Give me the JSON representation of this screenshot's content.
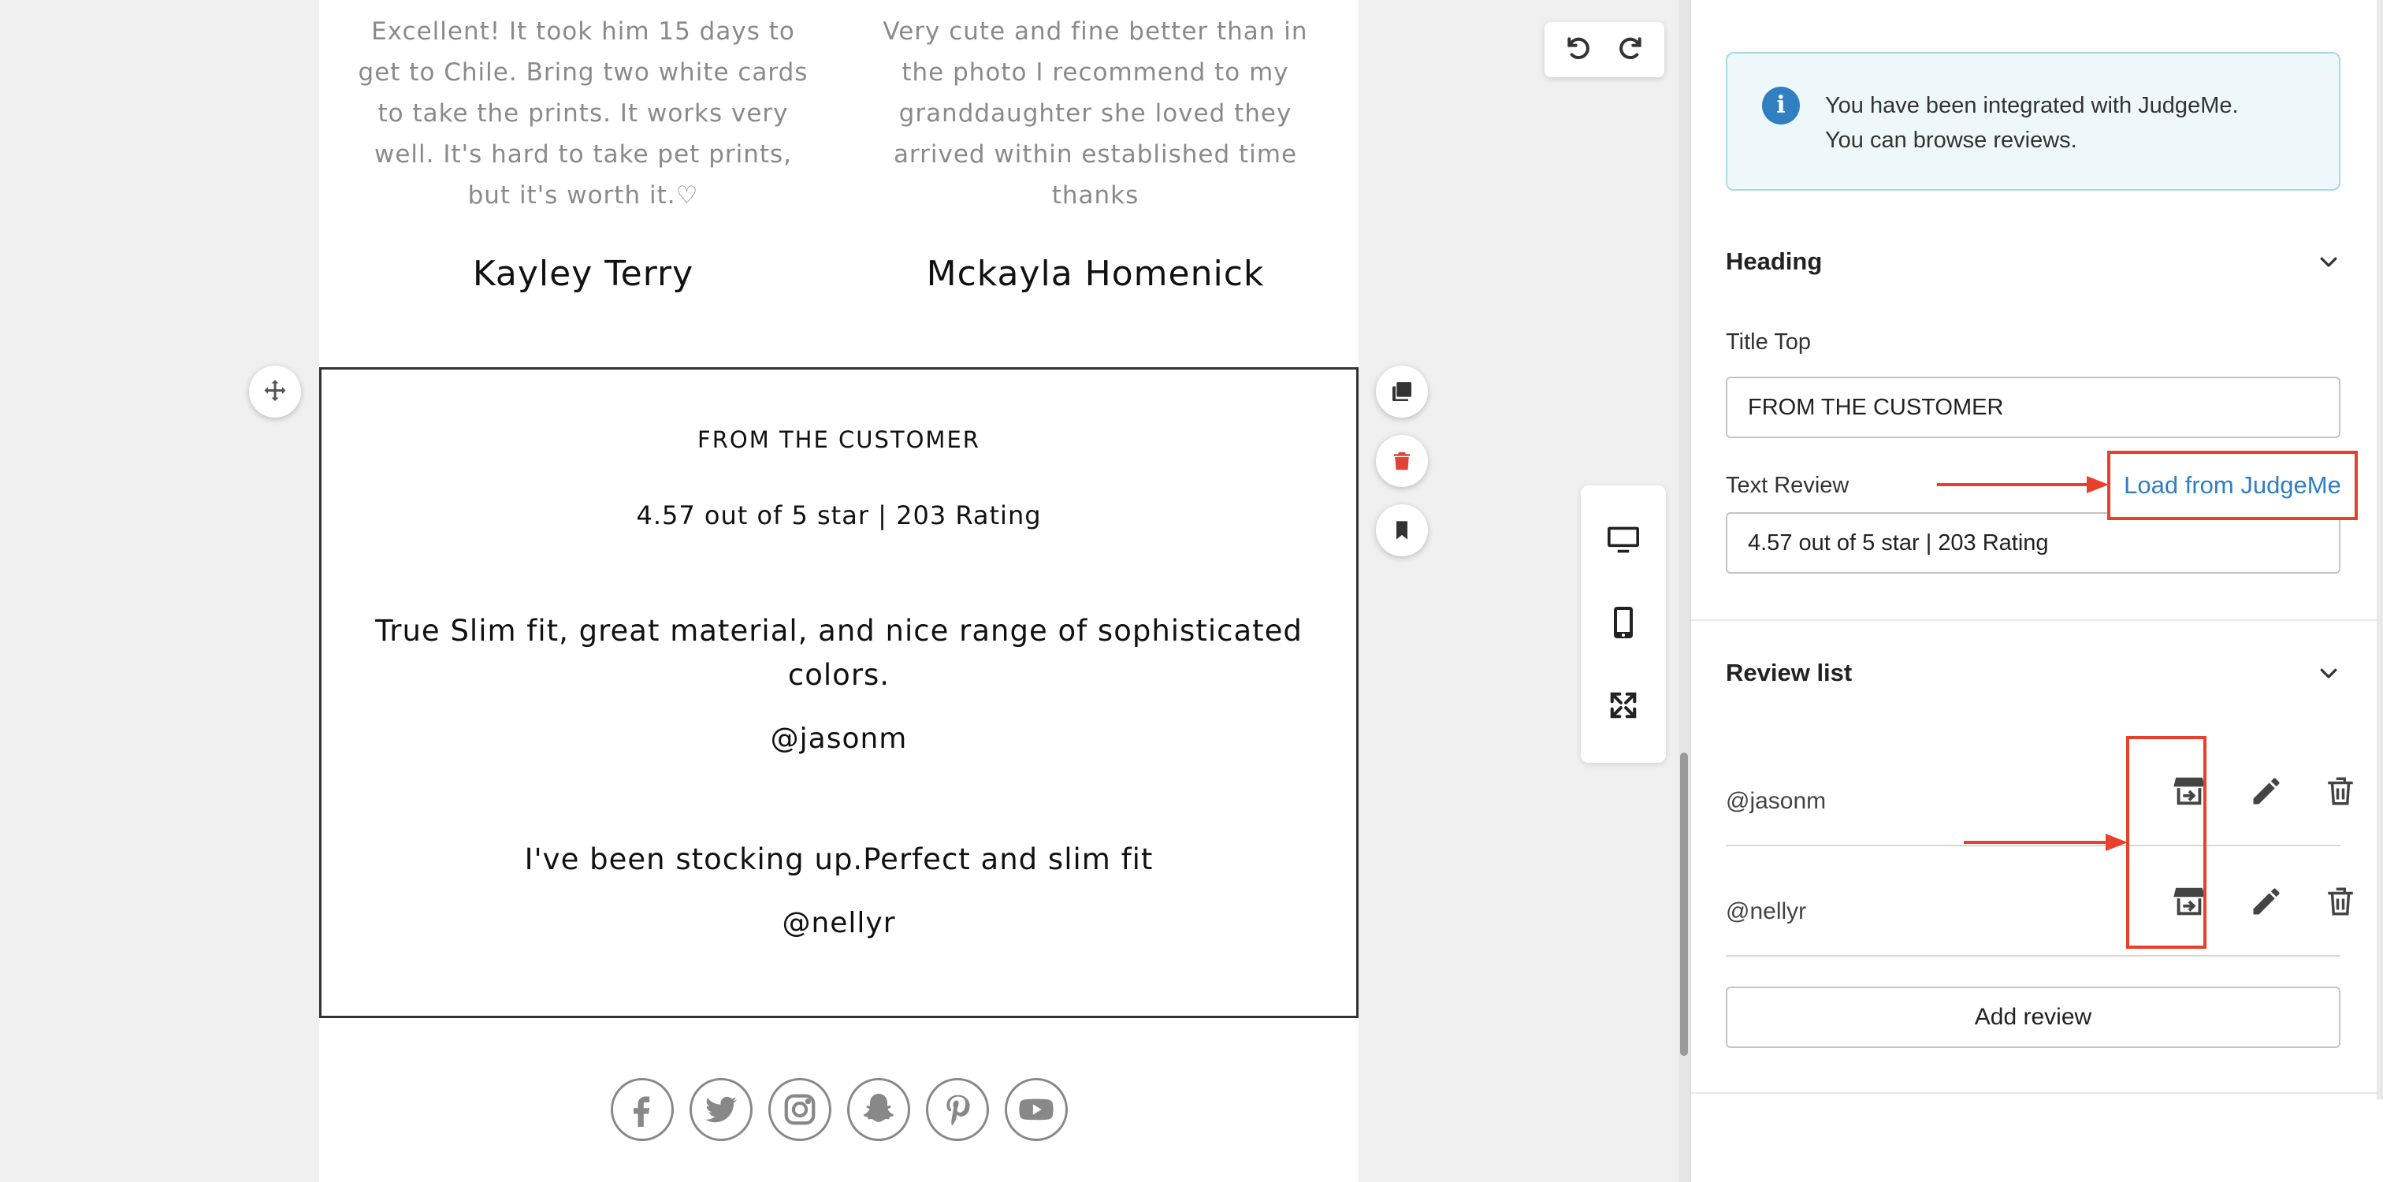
{
  "preview": {
    "prev_review_1": "Excellent! It took him 15 days to get to Chile. Bring two white cards to take the prints. It works very well. It's hard to take pet prints, but it's worth it.♡",
    "prev_review_2": "Very cute and fine better than in the photo I recommend to my granddaughter she loved they arrived within established time thanks",
    "prev_author_1": "Kayley Terry",
    "prev_author_2": "Mckayla Homenick"
  },
  "section": {
    "title_top": "FROM THE CUSTOMER",
    "rating_text": "4.57 out of 5 star | 203 Rating",
    "reviews": [
      {
        "text": "True Slim fit, great material, and nice range of sophisticated colors.",
        "author": "@jasonm"
      },
      {
        "text": "I've been stocking up.Perfect and slim fit",
        "author": "@nellyr"
      }
    ]
  },
  "social_icons": [
    "facebook-icon",
    "twitter-icon",
    "instagram-icon",
    "snapchat-icon",
    "pinterest-icon",
    "youtube-icon"
  ],
  "panel": {
    "info_line1": "You have been integrated with JudgeMe.",
    "info_line2": "You can browse reviews.",
    "heading_section": "Heading",
    "title_top_label": "Title Top",
    "title_top_value": "FROM THE CUSTOMER",
    "text_review_label": "Text Review",
    "load_button": "Load from JudgeMe",
    "text_review_value": "4.57 out of 5 star | 203 Rating",
    "review_list_section": "Review list",
    "review_authors": [
      "@jasonm",
      "@nellyr"
    ],
    "add_review_button": "Add review"
  },
  "colors": {
    "accent_red": "#e8402a",
    "link_blue": "#2f7fc1",
    "info_bg": "#eef8fa",
    "delete_red": "#e04436"
  }
}
